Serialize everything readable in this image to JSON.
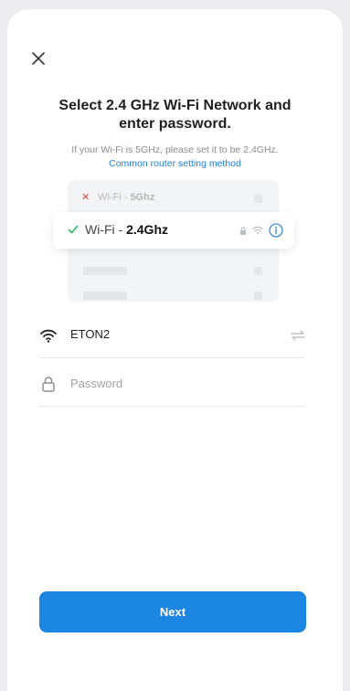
{
  "header": {
    "close_icon": "close-icon"
  },
  "title": "Select 2.4 GHz Wi-Fi Network and enter password.",
  "hint": "If your Wi-Fi is 5GHz, please set it to be 2.4GHz.",
  "hint_link": "Common router setting method",
  "illustration": {
    "bad_prefix": "Wi-Fi - ",
    "bad_band": "5Ghz",
    "good_prefix": "Wi-Fi - ",
    "good_band": "2.4Ghz",
    "colors": {
      "bad": "#e5453b",
      "good": "#2eb85c",
      "info": "#1a80e0"
    }
  },
  "form": {
    "ssid_value": "ETON2",
    "password_placeholder": "Password",
    "password_value": ""
  },
  "actions": {
    "next_label": "Next"
  },
  "colors": {
    "accent": "#1c86e3",
    "link": "#1a80e0"
  }
}
